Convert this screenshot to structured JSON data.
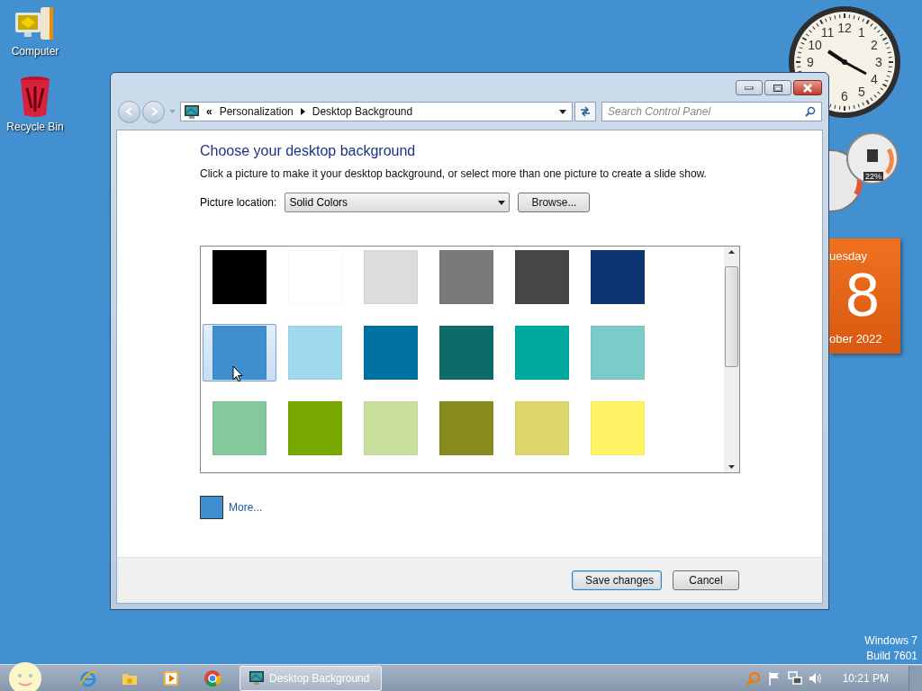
{
  "desktop_icons": [
    {
      "label": "Computer",
      "kind": "computer"
    },
    {
      "label": "Recycle Bin",
      "kind": "recycle-bin"
    }
  ],
  "gadgets": {
    "clock": {
      "numerals": [
        "12",
        "1",
        "2",
        "3",
        "4",
        "5",
        "6",
        "9",
        "10",
        "11"
      ]
    },
    "cpu_meter": {
      "reading": "22%"
    },
    "calendar": {
      "weekday": "uesday",
      "day": "8",
      "month_year": "ober 2022"
    }
  },
  "window": {
    "address": {
      "prefix": "«",
      "segments": [
        "Personalization",
        "Desktop Background"
      ]
    },
    "search": {
      "placeholder": "Search Control Panel"
    },
    "heading": "Choose your desktop background",
    "description": "Click a picture to make it your desktop background, or select more than one picture to create a slide show.",
    "location": {
      "label": "Picture location:",
      "value": "Solid Colors"
    },
    "browse_button": "Browse...",
    "swatches": [
      {
        "color": "#000000",
        "selected": false
      },
      {
        "color": "#ffffff",
        "selected": false
      },
      {
        "color": "#dcdcdc",
        "selected": false
      },
      {
        "color": "#7a7a7a",
        "selected": false
      },
      {
        "color": "#464646",
        "selected": false
      },
      {
        "color": "#0c3572",
        "selected": false
      },
      {
        "color": "#3f8fcf",
        "selected": true
      },
      {
        "color": "#a0d8ec",
        "selected": false
      },
      {
        "color": "#0072a0",
        "selected": false
      },
      {
        "color": "#0d6b68",
        "selected": false
      },
      {
        "color": "#00a99d",
        "selected": false
      },
      {
        "color": "#7dcbc8",
        "selected": false
      },
      {
        "color": "#84c99c",
        "selected": false
      },
      {
        "color": "#78a800",
        "selected": false
      },
      {
        "color": "#c8df9e",
        "selected": false
      },
      {
        "color": "#878a1c",
        "selected": false
      },
      {
        "color": "#dcd66c",
        "selected": false
      },
      {
        "color": "#fff466",
        "selected": false
      }
    ],
    "more": {
      "label": "More...",
      "color": "#3f8fcf"
    },
    "buttons": [
      {
        "label": "Save changes",
        "default": true
      },
      {
        "label": "Cancel",
        "default": false
      }
    ]
  },
  "os_info": [
    "Windows 7",
    "Build 7601"
  ],
  "taskbar": {
    "pinned": [
      {
        "kind": "browser"
      },
      {
        "kind": "folder"
      },
      {
        "kind": "media"
      },
      {
        "kind": "chrome"
      }
    ],
    "tasks": [
      {
        "label": "Desktop Background",
        "selected": true
      }
    ],
    "tray": [
      {
        "kind": "search"
      },
      {
        "kind": "flag"
      },
      {
        "kind": "network"
      },
      {
        "kind": "speaker"
      }
    ],
    "time": "10:21 PM"
  }
}
